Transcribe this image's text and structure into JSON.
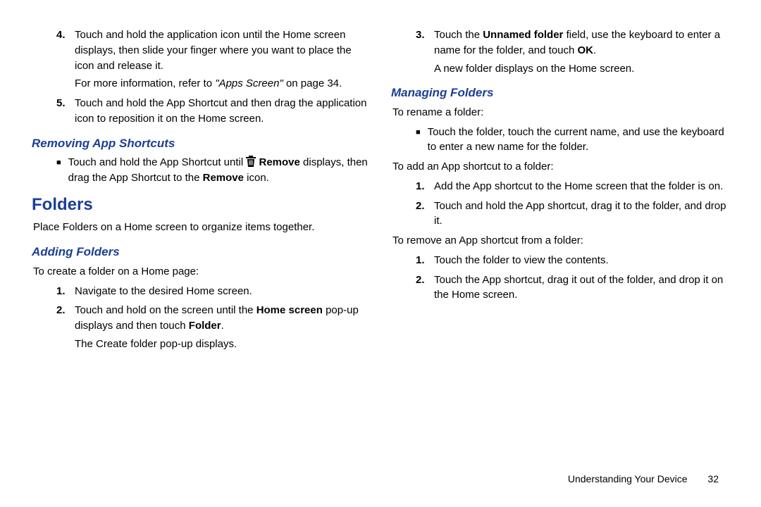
{
  "col1": {
    "step4": {
      "num": "4.",
      "text": "Touch and hold the application icon until the Home screen displays, then slide your finger where you want to place the icon and release it.",
      "more_pre": "For more information, refer to ",
      "more_italic": "\"Apps Screen\"",
      "more_post": " on page 34."
    },
    "step5": {
      "num": "5.",
      "text": "Touch and hold the App Shortcut and then drag the application icon to reposition it on the Home screen."
    },
    "removing_heading": "Removing App Shortcuts",
    "removing_bullet": {
      "pre": "Touch and hold the App Shortcut until ",
      "remove_label": " Remove",
      "mid": " displays, then drag the App Shortcut to the ",
      "remove2": "Remove",
      "post": " icon."
    },
    "folders_heading": "Folders",
    "folders_intro": "Place Folders on a Home screen to organize items together.",
    "adding_heading": "Adding Folders",
    "adding_intro": "To create a folder on a Home page:",
    "add_step1": {
      "num": "1.",
      "text": "Navigate to the desired Home screen."
    },
    "add_step2": {
      "num": "2.",
      "pre": "Touch and hold on the screen until the ",
      "b1": "Home screen",
      "mid": " pop-up displays and then touch ",
      "b2": "Folder",
      "post": ".",
      "sub": "The Create folder pop-up displays."
    }
  },
  "col2": {
    "step3": {
      "num": "3.",
      "pre": "Touch the ",
      "b1": "Unnamed folder",
      "mid": " field, use the keyboard to enter a name for the folder, and touch ",
      "b2": "OK",
      "post": ".",
      "sub": "A new folder displays on the Home screen."
    },
    "managing_heading": "Managing Folders",
    "rename_intro": "To rename a folder:",
    "rename_bullet": "Touch the folder, touch the current name, and use the keyboard to enter a new name for the folder.",
    "add_sc_intro": "To add an App shortcut to a folder:",
    "add_sc_step1": {
      "num": "1.",
      "text": "Add the App shortcut to the Home screen that the folder is on."
    },
    "add_sc_step2": {
      "num": "2.",
      "text": "Touch and hold the App shortcut, drag it to the folder, and drop it."
    },
    "rm_sc_intro": "To remove an App shortcut from a folder:",
    "rm_sc_step1": {
      "num": "1.",
      "text": "Touch the folder to view the contents."
    },
    "rm_sc_step2": {
      "num": "2.",
      "text": "Touch the App shortcut, drag it out of the folder, and drop it on the Home screen."
    }
  },
  "footer": {
    "chapter": "Understanding Your Device",
    "page": "32"
  }
}
